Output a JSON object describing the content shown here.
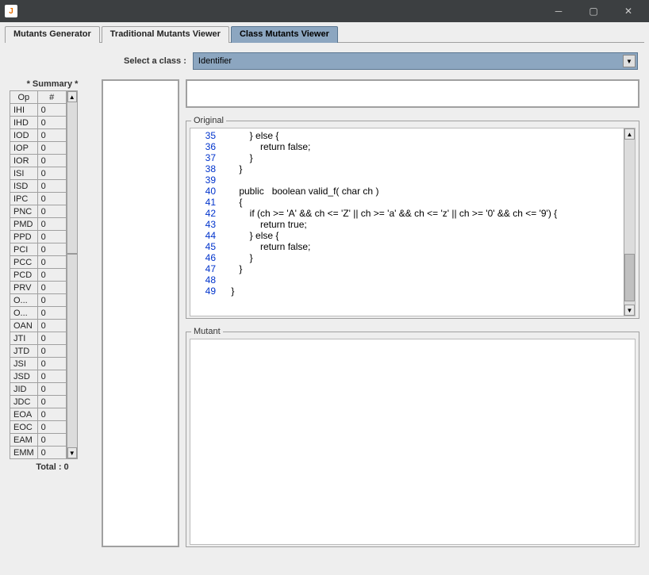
{
  "titlebar": {
    "icon_label": "J"
  },
  "tabs": [
    {
      "label": "Mutants Generator",
      "active": false
    },
    {
      "label": "Traditional Mutants Viewer",
      "active": false
    },
    {
      "label": "Class Mutants Viewer",
      "active": true
    }
  ],
  "class_selector": {
    "label": "Select a class :",
    "value": "Identifier"
  },
  "summary": {
    "title": "* Summary *",
    "headers": {
      "op": "Op",
      "count": "#"
    },
    "rows": [
      {
        "op": "IHI",
        "count": "0"
      },
      {
        "op": "IHD",
        "count": "0"
      },
      {
        "op": "IOD",
        "count": "0"
      },
      {
        "op": "IOP",
        "count": "0"
      },
      {
        "op": "IOR",
        "count": "0"
      },
      {
        "op": "ISI",
        "count": "0"
      },
      {
        "op": "ISD",
        "count": "0"
      },
      {
        "op": "IPC",
        "count": "0"
      },
      {
        "op": "PNC",
        "count": "0"
      },
      {
        "op": "PMD",
        "count": "0"
      },
      {
        "op": "PPD",
        "count": "0"
      },
      {
        "op": "PCI",
        "count": "0"
      },
      {
        "op": "PCC",
        "count": "0"
      },
      {
        "op": "PCD",
        "count": "0"
      },
      {
        "op": "PRV",
        "count": "0"
      },
      {
        "op": "O...",
        "count": "0"
      },
      {
        "op": "O...",
        "count": "0"
      },
      {
        "op": "OAN",
        "count": "0"
      },
      {
        "op": "JTI",
        "count": "0"
      },
      {
        "op": "JTD",
        "count": "0"
      },
      {
        "op": "JSI",
        "count": "0"
      },
      {
        "op": "JSD",
        "count": "0"
      },
      {
        "op": "JID",
        "count": "0"
      },
      {
        "op": "JDC",
        "count": "0"
      },
      {
        "op": "EOA",
        "count": "0"
      },
      {
        "op": "EOC",
        "count": "0"
      },
      {
        "op": "EAM",
        "count": "0"
      },
      {
        "op": "EMM",
        "count": "0"
      }
    ],
    "total_label": "Total : 0"
  },
  "original": {
    "label": "Original",
    "lines": [
      {
        "n": "35",
        "t": "        } else {"
      },
      {
        "n": "36",
        "t": "            return false;"
      },
      {
        "n": "37",
        "t": "        }"
      },
      {
        "n": "38",
        "t": "    }"
      },
      {
        "n": "39",
        "t": ""
      },
      {
        "n": "40",
        "t": "    public   boolean valid_f( char ch )"
      },
      {
        "n": "41",
        "t": "    {"
      },
      {
        "n": "42",
        "t": "        if (ch >= 'A' && ch <= 'Z' || ch >= 'a' && ch <= 'z' || ch >= '0' && ch <= '9') {"
      },
      {
        "n": "43",
        "t": "            return true;"
      },
      {
        "n": "44",
        "t": "        } else {"
      },
      {
        "n": "45",
        "t": "            return false;"
      },
      {
        "n": "46",
        "t": "        }"
      },
      {
        "n": "47",
        "t": "    }"
      },
      {
        "n": "48",
        "t": ""
      },
      {
        "n": "49",
        "t": " }"
      }
    ]
  },
  "mutant": {
    "label": "Mutant"
  }
}
